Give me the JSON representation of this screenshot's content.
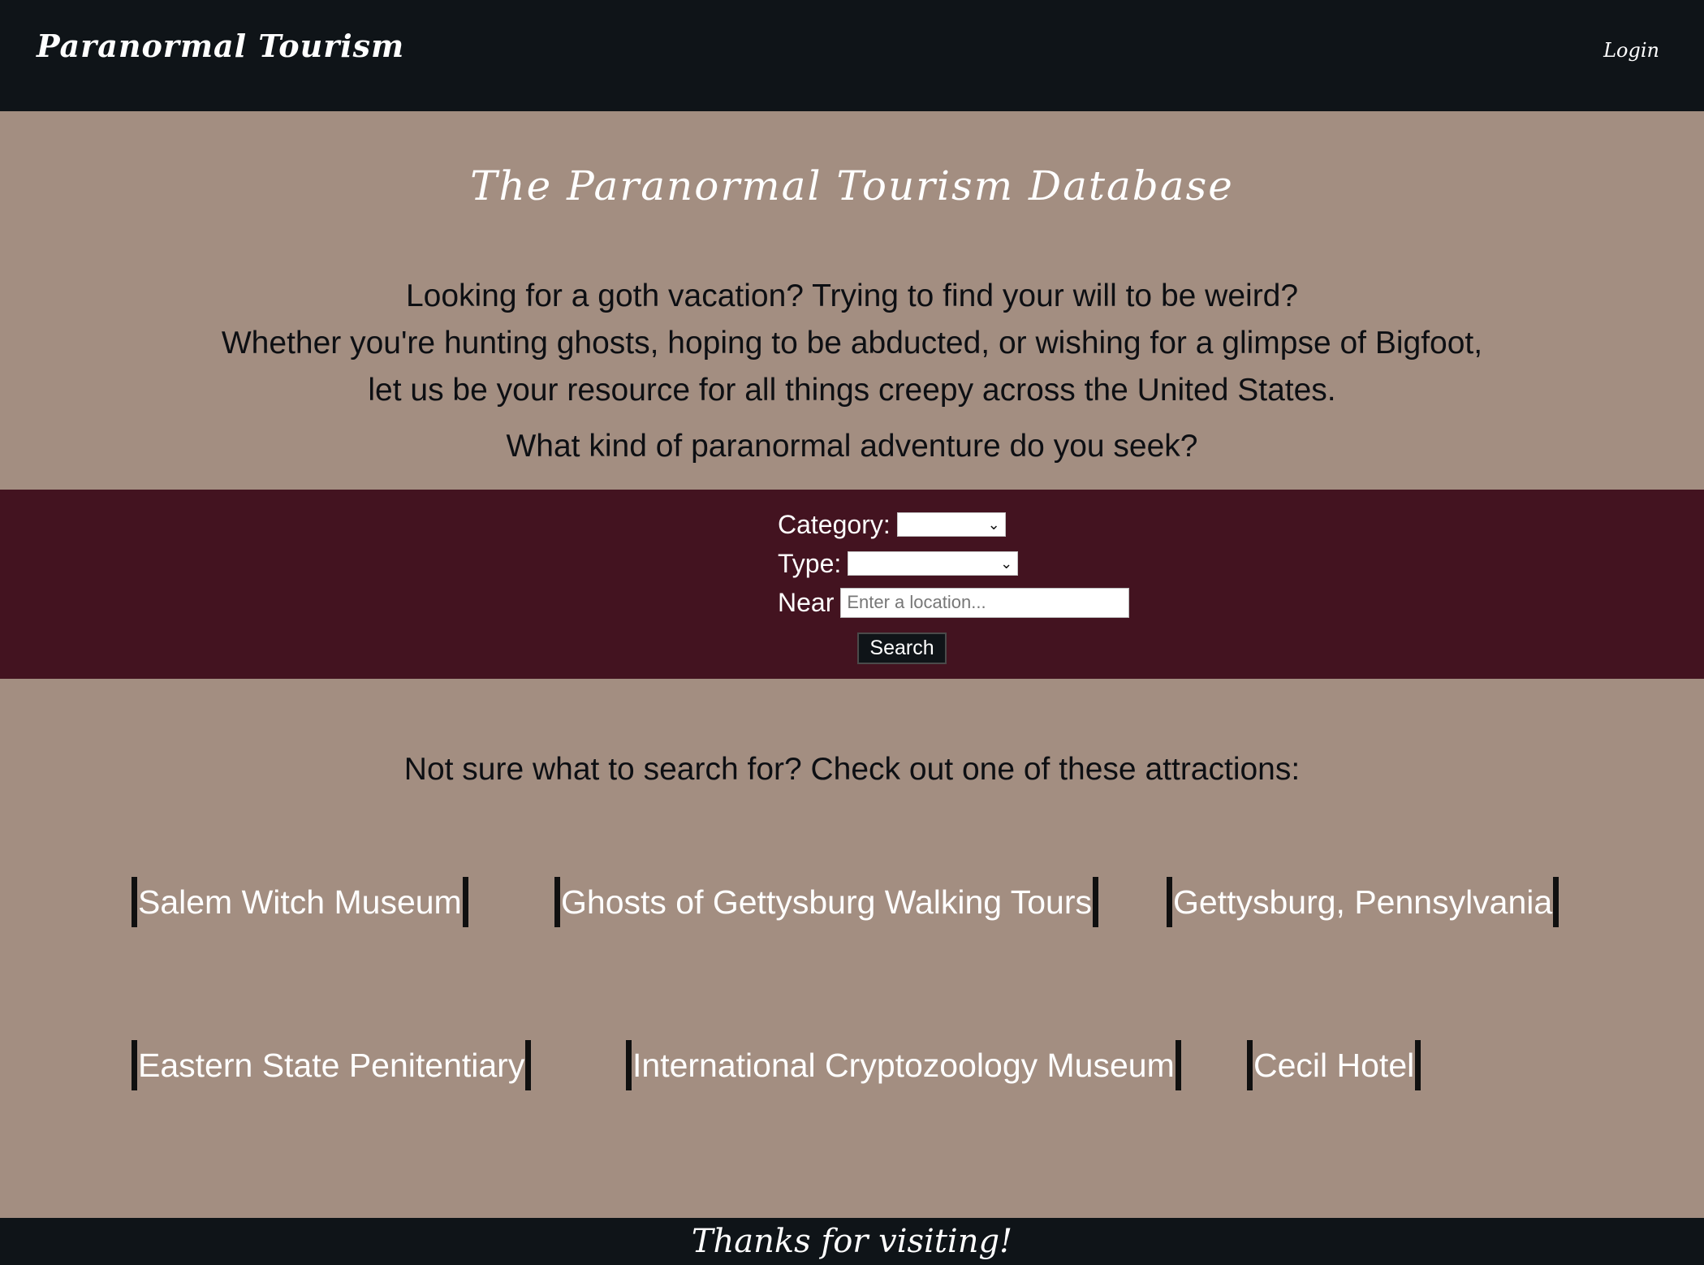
{
  "navbar": {
    "brand": "Paranormal Tourism",
    "login_label": "Login"
  },
  "hero": {
    "title": "The Paranormal Tourism Database",
    "intro_lines": [
      "Looking for a goth vacation? Trying to find your will to be weird?",
      "Whether you're hunting ghosts, hoping to be abducted, or wishing for a glimpse of Bigfoot,",
      "let us be your resource for all things creepy across the United States."
    ],
    "question": "What kind of paranormal adventure do you seek?"
  },
  "search": {
    "category_label": "Category:",
    "category_value": "",
    "type_label": "Type:",
    "type_value": "",
    "near_label": "Near",
    "near_placeholder": "Enter a location...",
    "near_value": "",
    "button_label": "Search"
  },
  "suggestions": {
    "heading": "Not sure what to search for? Check out one of these attractions:",
    "attractions": [
      "Salem Witch Museum",
      "Ghosts of Gettysburg Walking Tours",
      "Gettysburg, Pennsylvania",
      "Eastern State Penitentiary",
      "International Cryptozoology Museum",
      "Cecil Hotel"
    ]
  },
  "footer": {
    "text": "Thanks for visiting!"
  },
  "colors": {
    "page_background": "#a38e81",
    "navbar_background": "#0f1418",
    "search_band_background": "#431320",
    "text_light": "#ffffff",
    "text_dark": "#0d0f13"
  },
  "icons": {
    "dropdown": "chevron-down-icon"
  }
}
